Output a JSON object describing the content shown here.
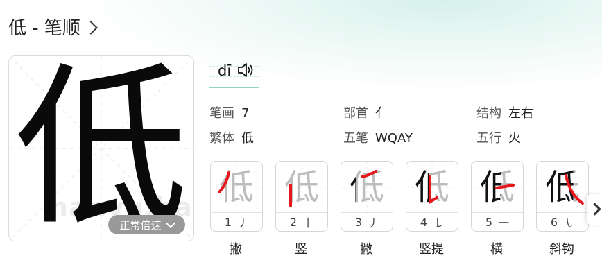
{
  "header": {
    "title": "低 - 笔顺"
  },
  "character": {
    "glyph": "低",
    "pinyin": "dī",
    "watermark": "hanyu.baidu",
    "speed_button": "正常倍速"
  },
  "info": {
    "strokes_label": "笔画",
    "strokes_value": "7",
    "radical_label": "部首",
    "radical_value": "亻",
    "structure_label": "结构",
    "structure_value": "左右",
    "traditional_label": "繁体",
    "traditional_value": "低",
    "wubi_label": "五笔",
    "wubi_value": "WQAY",
    "wuxing_label": "五行",
    "wuxing_value": "火"
  },
  "strokes": [
    {
      "num": "1",
      "shape": "丿",
      "name": "撇"
    },
    {
      "num": "2",
      "shape": "丨",
      "name": "竖"
    },
    {
      "num": "3",
      "shape": "丿",
      "name": "撇"
    },
    {
      "num": "4",
      "shape": "𠄌",
      "name": "竖提"
    },
    {
      "num": "5",
      "shape": "一",
      "name": "横"
    },
    {
      "num": "6",
      "shape": "㇂",
      "name": "斜钩"
    }
  ],
  "colors": {
    "highlight_stroke": "#e8171c",
    "drawn_stroke": "#111111",
    "pending_stroke": "#bdbdbd",
    "accent": "#8fd8c5"
  },
  "icons": {
    "speaker": "speaker-icon",
    "next": "chevron-right-icon",
    "speed": "chevron-down-icon"
  }
}
